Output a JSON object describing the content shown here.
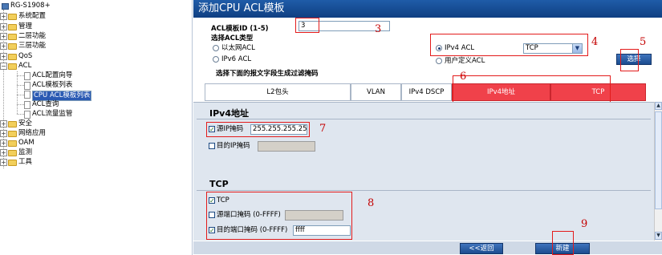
{
  "tree": {
    "root": "RG-S1908+",
    "items": [
      {
        "label": "系统配置"
      },
      {
        "label": "管理"
      },
      {
        "label": "二层功能"
      },
      {
        "label": "三层功能"
      },
      {
        "label": "QoS"
      },
      {
        "label": "ACL"
      },
      {
        "label": "ACL配置向导"
      },
      {
        "label": "ACL模板列表"
      },
      {
        "label": "CPU ACL模板列表"
      },
      {
        "label": "ACL查询"
      },
      {
        "label": "ACL流量监管"
      },
      {
        "label": "安全"
      },
      {
        "label": "网络应用"
      },
      {
        "label": "OAM"
      },
      {
        "label": "监测"
      },
      {
        "label": "工具"
      }
    ]
  },
  "page": {
    "title": "添加CPU ACL模板"
  },
  "form": {
    "template_id_label": "ACL模板ID (1-5)",
    "template_id_value": "3",
    "type_label": "选择ACL类型",
    "options": {
      "ethernet": "以太网ACL",
      "ipv6": "IPv6 ACL",
      "ipv4": "IPv4 ACL",
      "user": "用户定义ACL"
    },
    "protocol_value": "TCP",
    "select_button": "选择",
    "mask_hint": "选择下面的报文字段生成过滤掩码"
  },
  "tabs": [
    {
      "label": "L2包头",
      "active": false
    },
    {
      "label": "VLAN",
      "active": false
    },
    {
      "label": "IPv4 DSCP",
      "active": false
    },
    {
      "label": "IPv4地址",
      "active": true
    },
    {
      "label": "TCP",
      "active": true
    }
  ],
  "ipv4_section": {
    "title": "IPv4地址",
    "src_label": "源IP掩码",
    "src_value": "255.255.255.255",
    "dst_label": "目的IP掩码",
    "dst_value": ""
  },
  "tcp_section": {
    "title": "TCP",
    "tcp_label": "TCP",
    "src_port_label": "源端口掩码 (0-FFFF)",
    "src_port_value": "",
    "dst_port_label": "目的端口掩码 (0-FFFF)",
    "dst_port_value": "ffff"
  },
  "footer": {
    "back_button": "<<返回",
    "new_button": "新建"
  },
  "annotations": [
    "3",
    "4",
    "5",
    "6",
    "7",
    "8",
    "9"
  ],
  "colors": {
    "title_bar": "#1f5ca8",
    "active_tab": "#f0414a",
    "annotation": "#c40000",
    "selected_tree_item": "#2a5ab3"
  }
}
